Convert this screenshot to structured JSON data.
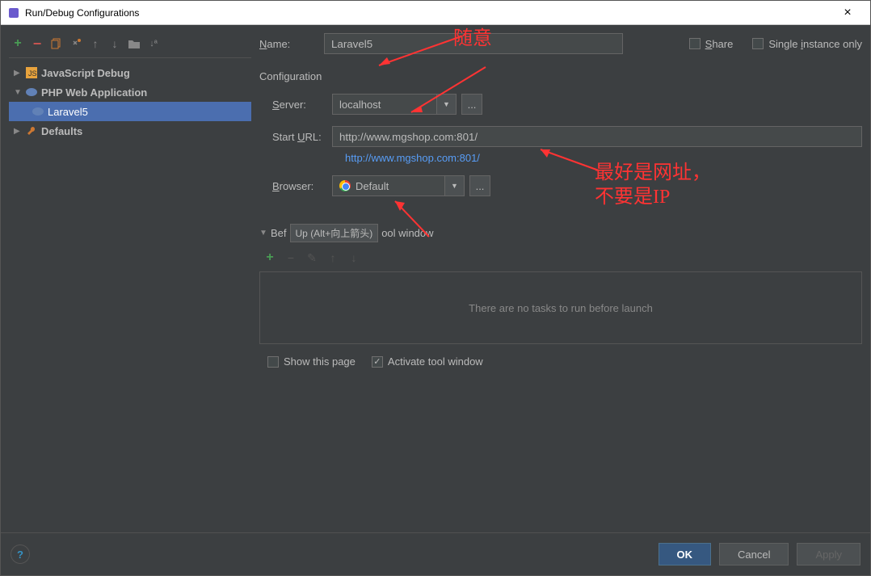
{
  "titlebar": {
    "title": "Run/Debug Configurations"
  },
  "tree": {
    "items": [
      {
        "label": "JavaScript Debug",
        "expanded": false
      },
      {
        "label": "PHP Web Application",
        "expanded": true
      },
      {
        "label": "Laravel5",
        "selected": true
      },
      {
        "label": "Defaults",
        "expanded": false
      }
    ]
  },
  "form": {
    "name_label": "Name:",
    "name_value": "Laravel5",
    "share_label": "Share",
    "single_label": "Single instance only",
    "config_head": "Configuration",
    "server_label": "Server:",
    "server_value": "localhost",
    "url_label": "Start URL:",
    "url_value": "http://www.mgshop.com:801/",
    "url_link": "http://www.mgshop.com:801/",
    "browser_label": "Browser:",
    "browser_value": "Default",
    "before_prefix": "Bef",
    "tooltip": "Up (Alt+向上箭头)",
    "before_suffix": "ool window",
    "no_tasks": "There are no tasks to run before launch",
    "show_page": "Show this page",
    "activate_window": "Activate tool window"
  },
  "footer": {
    "ok": "OK",
    "cancel": "Cancel",
    "apply": "Apply"
  },
  "annotations": {
    "a1": "随意",
    "a2": "最好是网址，",
    "a3": "不要是IP"
  }
}
